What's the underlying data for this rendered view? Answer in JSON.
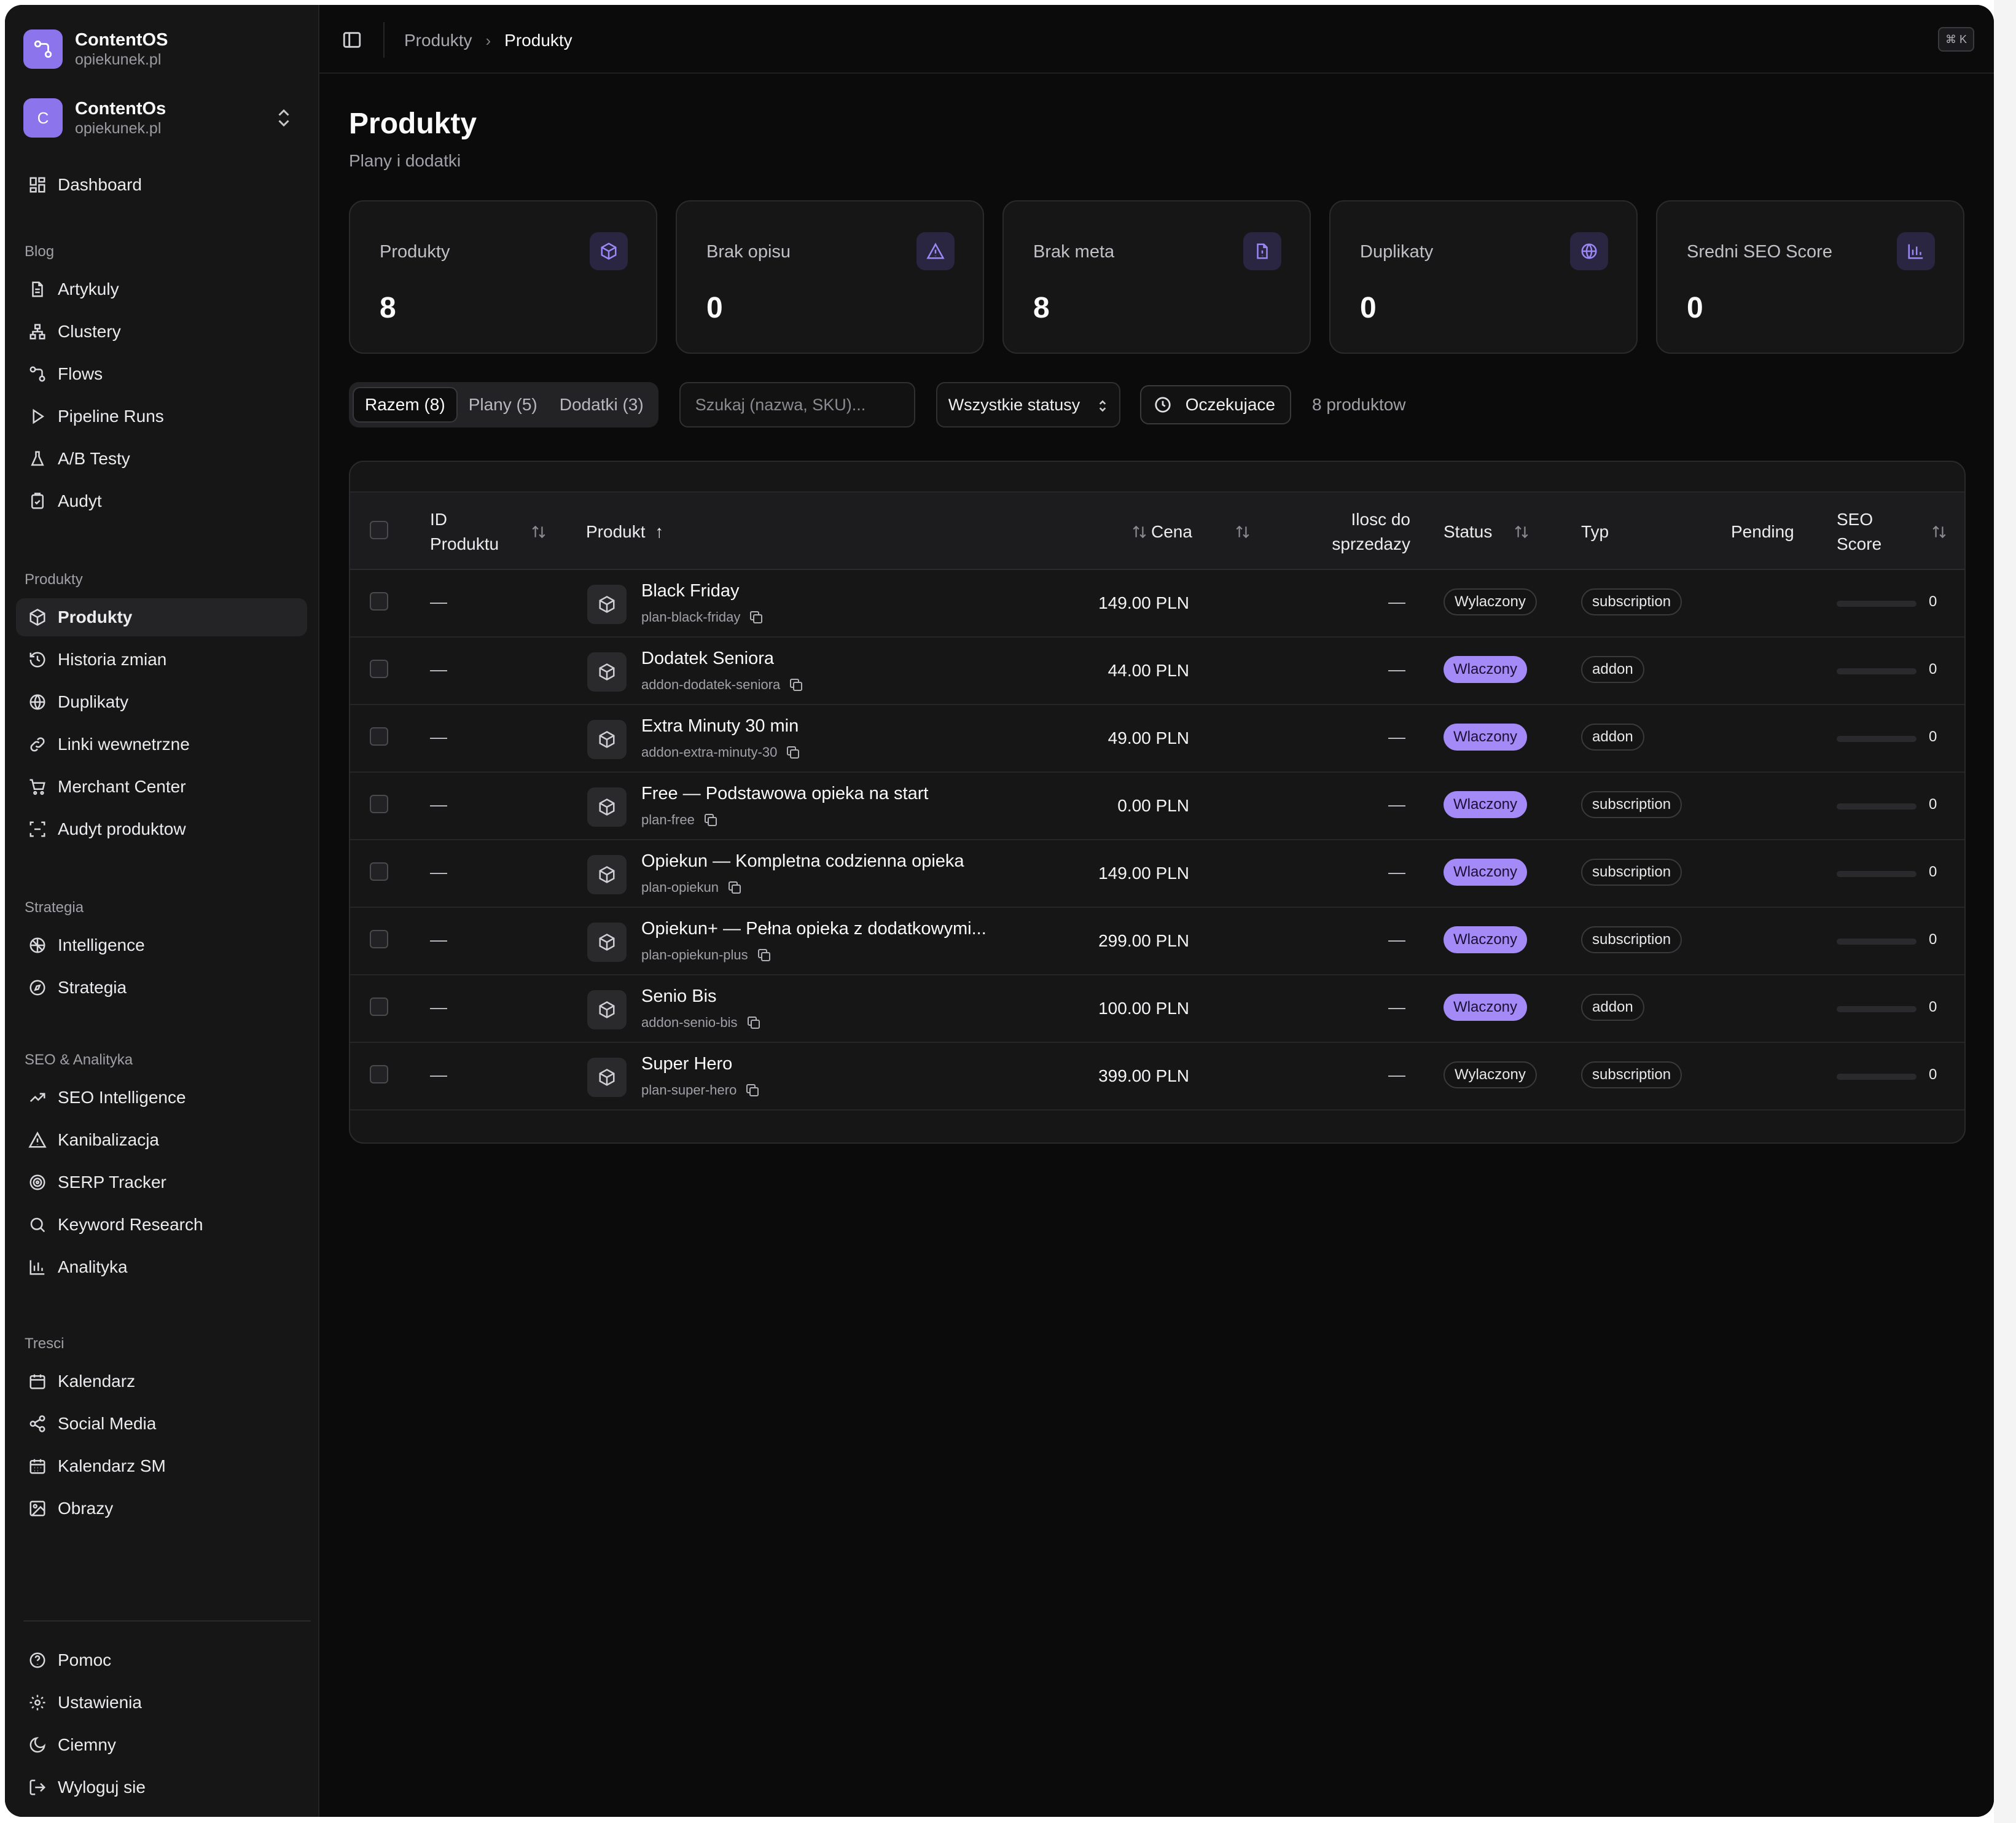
{
  "sidebar": {
    "workspace": {
      "name": "ContentOS",
      "domain": "opiekunek.pl"
    },
    "account": {
      "initial": "C",
      "name": "ContentOs",
      "domain": "opiekunek.pl"
    },
    "dashboard": "Dashboard",
    "sections": {
      "blog": "Blog",
      "produkty": "Produkty",
      "strategia": "Strategia",
      "seo": "SEO & Analityka",
      "tresci": "Tresci"
    },
    "blog_items": [
      "Artykuly",
      "Clustery",
      "Flows",
      "Pipeline Runs",
      "A/B Testy",
      "Audyt"
    ],
    "produkty_items": [
      "Produkty",
      "Historia zmian",
      "Duplikaty",
      "Linki wewnetrzne",
      "Merchant Center",
      "Audyt produktow"
    ],
    "strategia_items": [
      "Intelligence",
      "Strategia"
    ],
    "seo_items": [
      "SEO Intelligence",
      "Kanibalizacja",
      "SERP Tracker",
      "Keyword Research",
      "Analityka"
    ],
    "tresci_items": [
      "Kalendarz",
      "Social Media",
      "Kalendarz SM",
      "Obrazy"
    ],
    "footer_items": [
      "Pomoc",
      "Ustawienia",
      "Ciemny",
      "Wyloguj sie"
    ]
  },
  "topbar": {
    "breadcrumb": [
      "Produkty",
      "Produkty"
    ],
    "shortcut": "⌘ K"
  },
  "page": {
    "title": "Produkty",
    "subtitle": "Plany i dodatki"
  },
  "stats": [
    {
      "label": "Produkty",
      "value": "8",
      "icon": "box-icon"
    },
    {
      "label": "Brak opisu",
      "value": "0",
      "icon": "warning-icon"
    },
    {
      "label": "Brak meta",
      "value": "8",
      "icon": "file-alert-icon"
    },
    {
      "label": "Duplikaty",
      "value": "0",
      "icon": "globe-icon"
    },
    {
      "label": "Sredni SEO Score",
      "value": "0",
      "icon": "bar-chart-icon"
    }
  ],
  "filters": {
    "tabs": [
      "Razem (8)",
      "Plany (5)",
      "Dodatki (3)"
    ],
    "active_tab": 0,
    "search_placeholder": "Szukaj (nazwa, SKU)...",
    "status_select": "Wszystkie statusy",
    "pending_button": "Oczekujace",
    "count": "8 produktow"
  },
  "table": {
    "columns": {
      "id_line1": "ID",
      "id_line2": "Produktu",
      "product": "Produkt",
      "price": "Cena",
      "qty_line1": "Ilosc do",
      "qty_line2": "sprzedazy",
      "status": "Status",
      "type": "Typ",
      "pending": "Pending",
      "seo_line1": "SEO",
      "seo_line2": "Score"
    },
    "rows": [
      {
        "id": "—",
        "name": "Black Friday",
        "sku": "plan-black-friday",
        "price": "149.00 PLN",
        "qty": "—",
        "status": "Wylaczony",
        "status_on": false,
        "type": "subscription",
        "seo": "0"
      },
      {
        "id": "—",
        "name": "Dodatek Seniora",
        "sku": "addon-dodatek-seniora",
        "price": "44.00 PLN",
        "qty": "—",
        "status": "Wlaczony",
        "status_on": true,
        "type": "addon",
        "seo": "0"
      },
      {
        "id": "—",
        "name": "Extra Minuty 30 min",
        "sku": "addon-extra-minuty-30",
        "price": "49.00 PLN",
        "qty": "—",
        "status": "Wlaczony",
        "status_on": true,
        "type": "addon",
        "seo": "0"
      },
      {
        "id": "—",
        "name": "Free — Podstawowa opieka na start",
        "sku": "plan-free",
        "price": "0.00 PLN",
        "qty": "—",
        "status": "Wlaczony",
        "status_on": true,
        "type": "subscription",
        "seo": "0"
      },
      {
        "id": "—",
        "name": "Opiekun — Kompletna codzienna opieka",
        "sku": "plan-opiekun",
        "price": "149.00 PLN",
        "qty": "—",
        "status": "Wlaczony",
        "status_on": true,
        "type": "subscription",
        "seo": "0"
      },
      {
        "id": "—",
        "name": "Opiekun+ — Pełna opieka z dodatkowymi...",
        "sku": "plan-opiekun-plus",
        "price": "299.00 PLN",
        "qty": "—",
        "status": "Wlaczony",
        "status_on": true,
        "type": "subscription",
        "seo": "0"
      },
      {
        "id": "—",
        "name": "Senio Bis",
        "sku": "addon-senio-bis",
        "price": "100.00 PLN",
        "qty": "—",
        "status": "Wlaczony",
        "status_on": true,
        "type": "addon",
        "seo": "0"
      },
      {
        "id": "—",
        "name": "Super Hero",
        "sku": "plan-super-hero",
        "price": "399.00 PLN",
        "qty": "—",
        "status": "Wylaczony",
        "status_on": false,
        "type": "subscription",
        "seo": "0"
      }
    ]
  },
  "colors": {
    "accent": "#a48af7",
    "background": "#0b0b0c",
    "sidebar": "#161617"
  }
}
